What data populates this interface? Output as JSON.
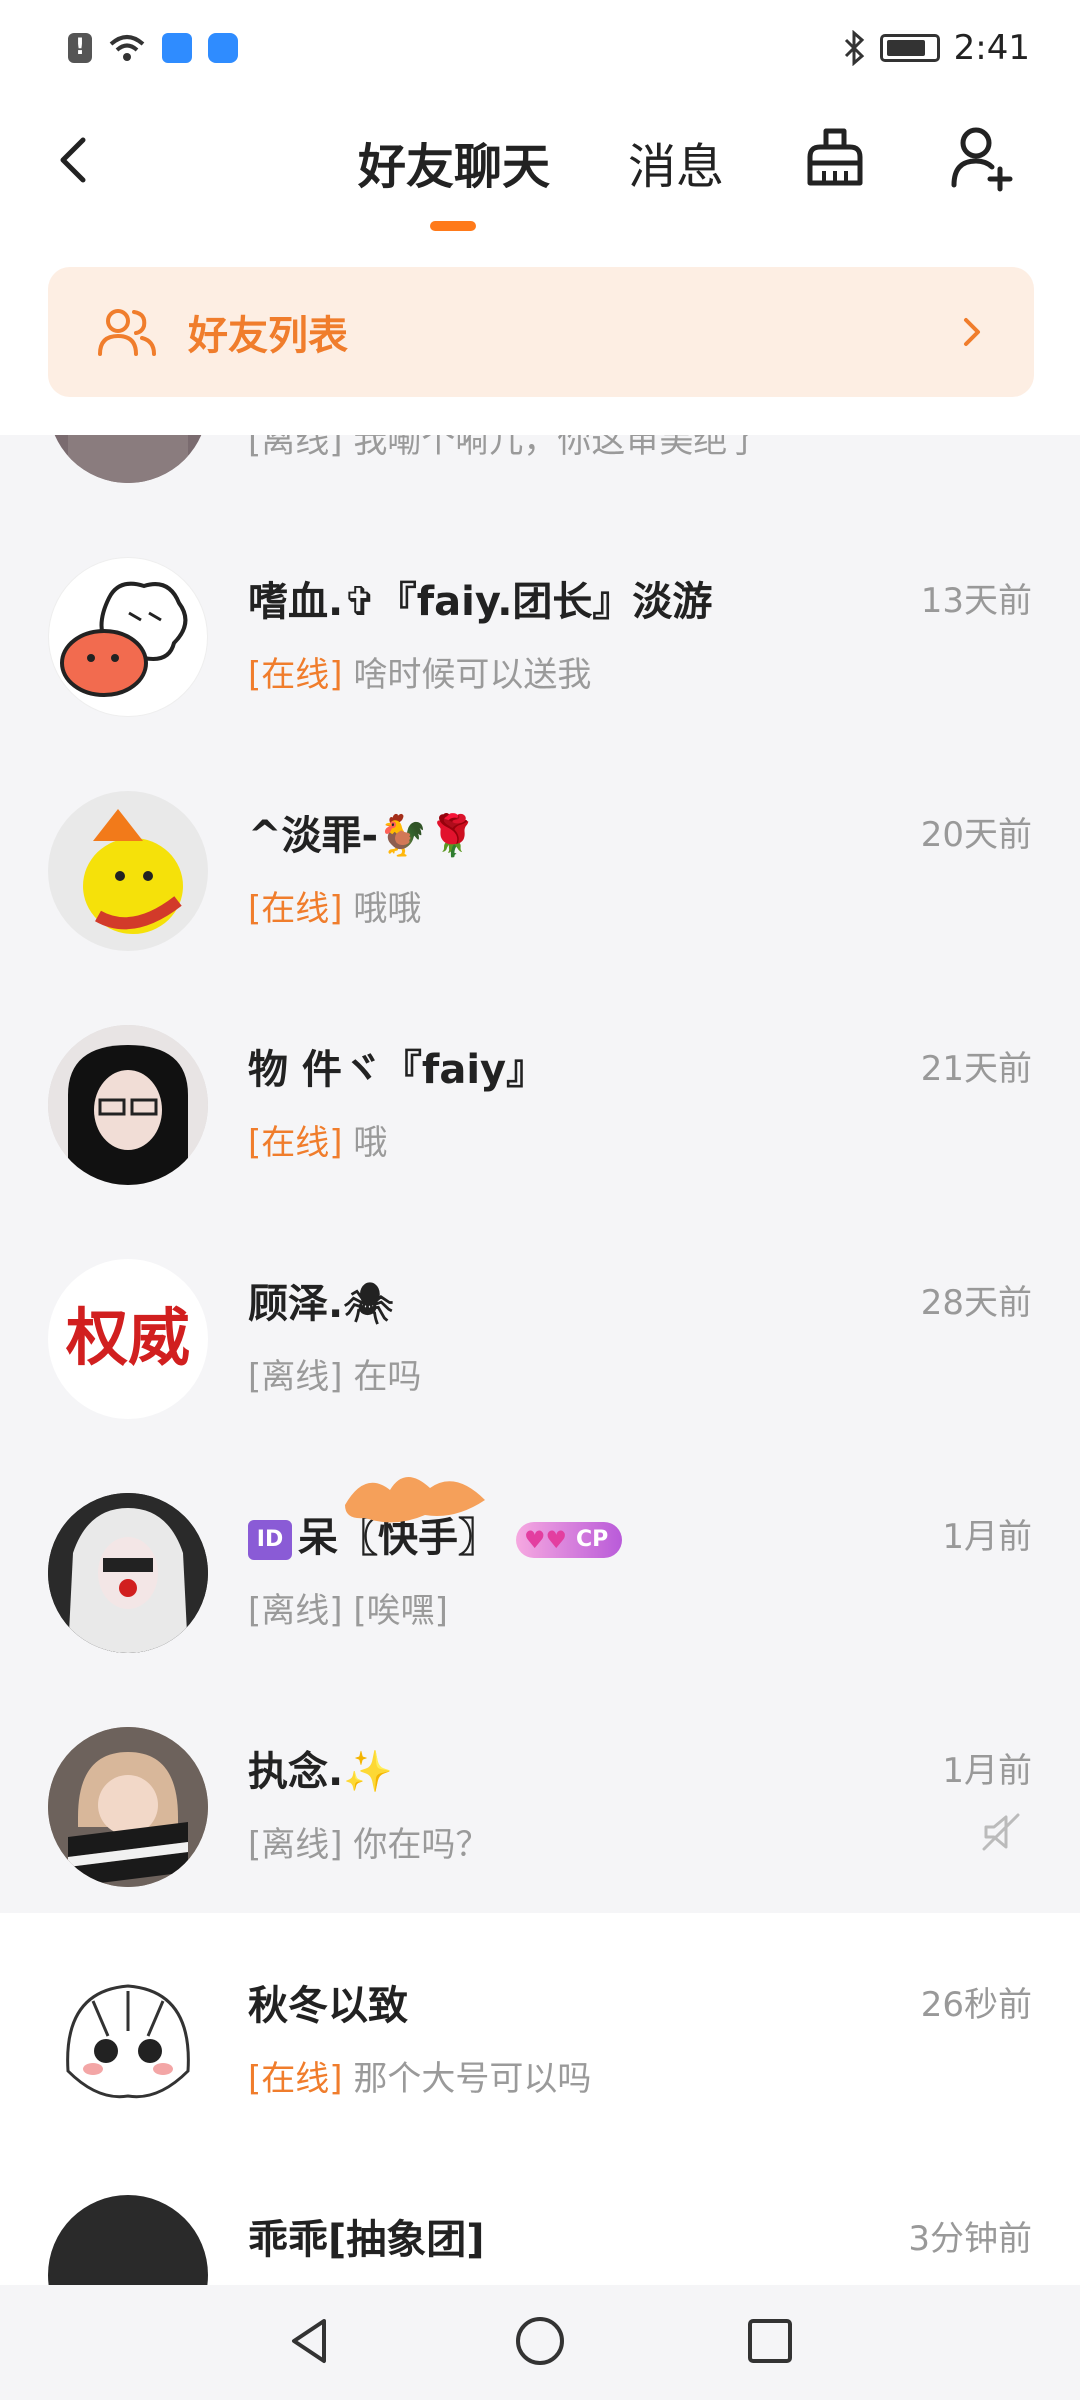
{
  "status_bar": {
    "time": "2:41",
    "icons": [
      "alert-icon",
      "wifi-icon",
      "app-store-icon",
      "cloud-icon",
      "bluetooth-icon",
      "battery-icon"
    ]
  },
  "header": {
    "tabs": [
      {
        "label": "好友聊天",
        "active": true
      },
      {
        "label": "消息",
        "active": false
      }
    ],
    "accent_color": "#ff7a1a",
    "icons": [
      "back-icon",
      "clean-icon",
      "add-friend-icon"
    ]
  },
  "friends_list_banner": {
    "label": "好友列表",
    "bg_color": "#fdeee3",
    "text_color": "#f07d2c"
  },
  "conversations": [
    {
      "name": "",
      "status": "[离线]",
      "online": false,
      "message": "我嘞个嗬儿，你这审美绝了",
      "time": ""
    },
    {
      "name": "嗜血.✞『faiy.团长』淡游",
      "status": "[在线]",
      "online": true,
      "message": "啥时候可以送我",
      "time": "13天前"
    },
    {
      "name": "^淡罪-🐓🌹",
      "status": "[在线]",
      "online": true,
      "message": "哦哦",
      "time": "20天前"
    },
    {
      "name": "物 件ヾ『faiy』",
      "status": "[在线]",
      "online": true,
      "message": "哦",
      "time": "21天前"
    },
    {
      "name": "顾泽.🕷",
      "status": "[离线]",
      "online": false,
      "message": "在吗",
      "time": "28天前"
    },
    {
      "name": "呆〖快手〗",
      "id_chip": "ID",
      "badge": "CP",
      "status": "[离线]",
      "online": false,
      "message": "[唉嘿]",
      "time": "1月前"
    },
    {
      "name": "执念.✨",
      "status": "[离线]",
      "online": false,
      "message": "你在吗？",
      "time": "1月前",
      "muted": true
    },
    {
      "name": "秋冬以致",
      "status": "[在线]",
      "online": true,
      "message": "那个大号可以吗",
      "time": "26秒前"
    },
    {
      "name": "乖乖[抽象团]",
      "status": "",
      "online": false,
      "message": "",
      "time": "3分钟前"
    }
  ],
  "avatar_texts": {
    "guze": "权威"
  },
  "nav_bar": {
    "icons": [
      "nav-back-icon",
      "nav-home-icon",
      "nav-recents-icon"
    ]
  }
}
